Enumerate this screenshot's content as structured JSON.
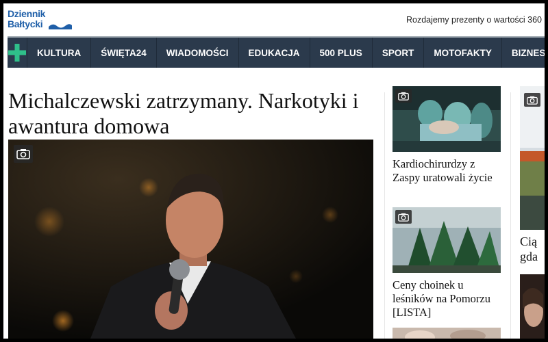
{
  "header": {
    "logo_line1": "Dziennik",
    "logo_line2": "Bałtycki",
    "promo_text": "Rozdajemy prezenty o wartości 360"
  },
  "nav": {
    "items": [
      "KULTURA",
      "ŚWIĘTA24",
      "WIADOMOŚCI",
      "EDUKACJA",
      "500 PLUS",
      "SPORT",
      "MOTOFAKTY",
      "BIZNES"
    ]
  },
  "article": {
    "headline": "Michalczewski zatrzymany. Narkotyki i awantura domowa"
  },
  "side": {
    "cards": [
      {
        "title": "Kardiochirurdzy z Zaspy uratowali życie"
      },
      {
        "title": "Ceny choinek u leśników na Pomorzu [LISTA]"
      }
    ],
    "far_title": "Cią gda"
  },
  "colors": {
    "nav_bg": "#2b3a4c",
    "plus_green": "#2fc08a",
    "logo_blue": "#1f5fa8"
  },
  "icons": [
    "plus-icon",
    "camera-icon",
    "wave-logo-icon"
  ]
}
